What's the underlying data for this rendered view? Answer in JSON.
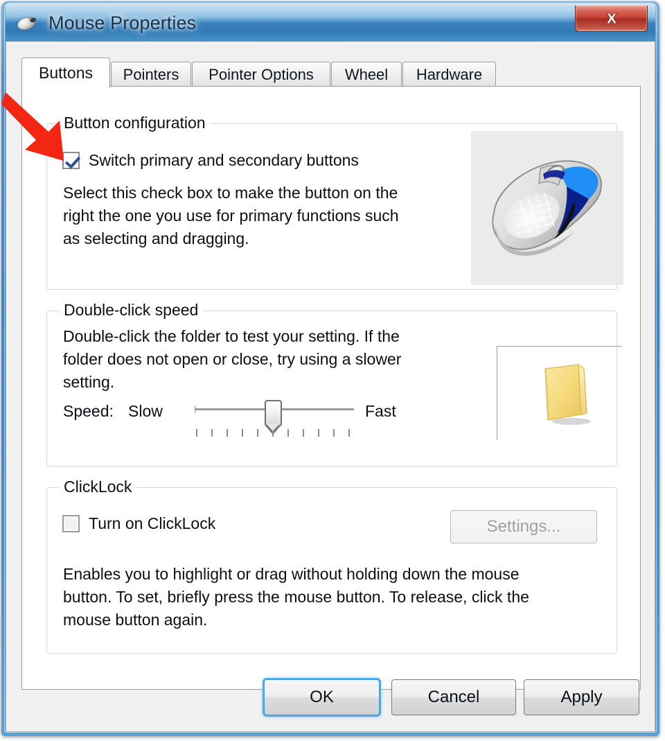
{
  "window": {
    "title": "Mouse Properties",
    "icon": "mouse-icon",
    "close_label": "✖",
    "accent_blue": "#3c83bd",
    "close_red": "#c14032"
  },
  "tabs": [
    {
      "label": "Buttons",
      "selected": true
    },
    {
      "label": "Pointers",
      "selected": false
    },
    {
      "label": "Pointer Options",
      "selected": false
    },
    {
      "label": "Wheel",
      "selected": false
    },
    {
      "label": "Hardware",
      "selected": false
    }
  ],
  "button_configuration": {
    "group_title": "Button configuration",
    "switch_buttons": {
      "label": "Switch primary and secondary buttons",
      "checked": true
    },
    "description_lines": [
      "Select this check box to make the button on the",
      "right the one you use for primary functions such",
      "as selecting and dragging."
    ],
    "preview_icon": "mouse-preview-image"
  },
  "double_click_speed": {
    "group_title": "Double-click speed",
    "description_lines": [
      "Double-click the folder to test your setting. If the",
      "folder does not open or close, try using a slower",
      "setting."
    ],
    "speed_label": "Speed:",
    "slow_label": "Slow",
    "fast_label": "Fast",
    "slider_value": 6,
    "slider_min": 1,
    "slider_max": 11,
    "tick_count": 11,
    "folder_icon": "folder-icon"
  },
  "clicklock": {
    "group_title": "ClickLock",
    "turn_on": {
      "label": "Turn on ClickLock",
      "checked": false
    },
    "settings_button": {
      "label": "Settings...",
      "enabled": false
    },
    "description_lines": [
      "Enables you to highlight or drag without holding down the mouse",
      "button. To set, briefly press the mouse button. To release, click the",
      "mouse button again."
    ]
  },
  "dialog_buttons": {
    "ok": "OK",
    "cancel": "Cancel",
    "apply": "Apply"
  },
  "annotation": {
    "type": "red-arrow",
    "color": "#f22613",
    "points_to": "switch-primary-secondary-checkbox"
  }
}
